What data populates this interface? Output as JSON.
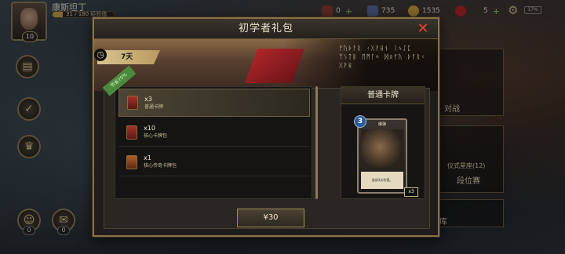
{
  "player": {
    "name": "康斯坦丁",
    "level": "10",
    "xp_text": "31 / 180 经验值",
    "xp_progress": 0.172
  },
  "resources": [
    {
      "icon": "pack-icon",
      "value": "0",
      "color": "#8a3a34"
    },
    {
      "icon": "card-dust-icon",
      "value": "735",
      "color": "#5a6a9a"
    },
    {
      "icon": "gold-icon",
      "value": "1535",
      "color": "#c9a043"
    },
    {
      "icon": "ruby-icon",
      "value": "5",
      "color": "#b0262a"
    }
  ],
  "status": {
    "battery": "17%"
  },
  "side_menu": {
    "friends_count": "0",
    "mail_count": "0"
  },
  "right_menu": {
    "battle_label": "对战",
    "ranked_sub": "仪式星座(12)",
    "ranked_label": "段位赛",
    "library_label": "库"
  },
  "modal": {
    "title": "初学者礼包",
    "timer": "7天",
    "new_tag": "节省70%",
    "banner_runes": "ᚠᚢᚦᚨᚱ ᚲᚷᚹᚺᚾ ᛁᛃᛇᛈ ᛉᛊᛏᛒ ᛖᛗᛚᛜ ᛞᛟᚠᚢ ᚦᚨᚱᚲ ᚷᚹᚺ",
    "items": [
      {
        "qty": "x3",
        "name": "普通卡牌"
      },
      {
        "qty": "x10",
        "name": "核心卡牌包"
      },
      {
        "qty": "x1",
        "name": "核心传奇卡牌包"
      }
    ],
    "preview": {
      "title": "普通卡牌",
      "card_cost": "3",
      "card_name": "爆弹",
      "card_desc": "造成3点伤害。",
      "multiplier": "x3"
    },
    "price": "¥30"
  }
}
